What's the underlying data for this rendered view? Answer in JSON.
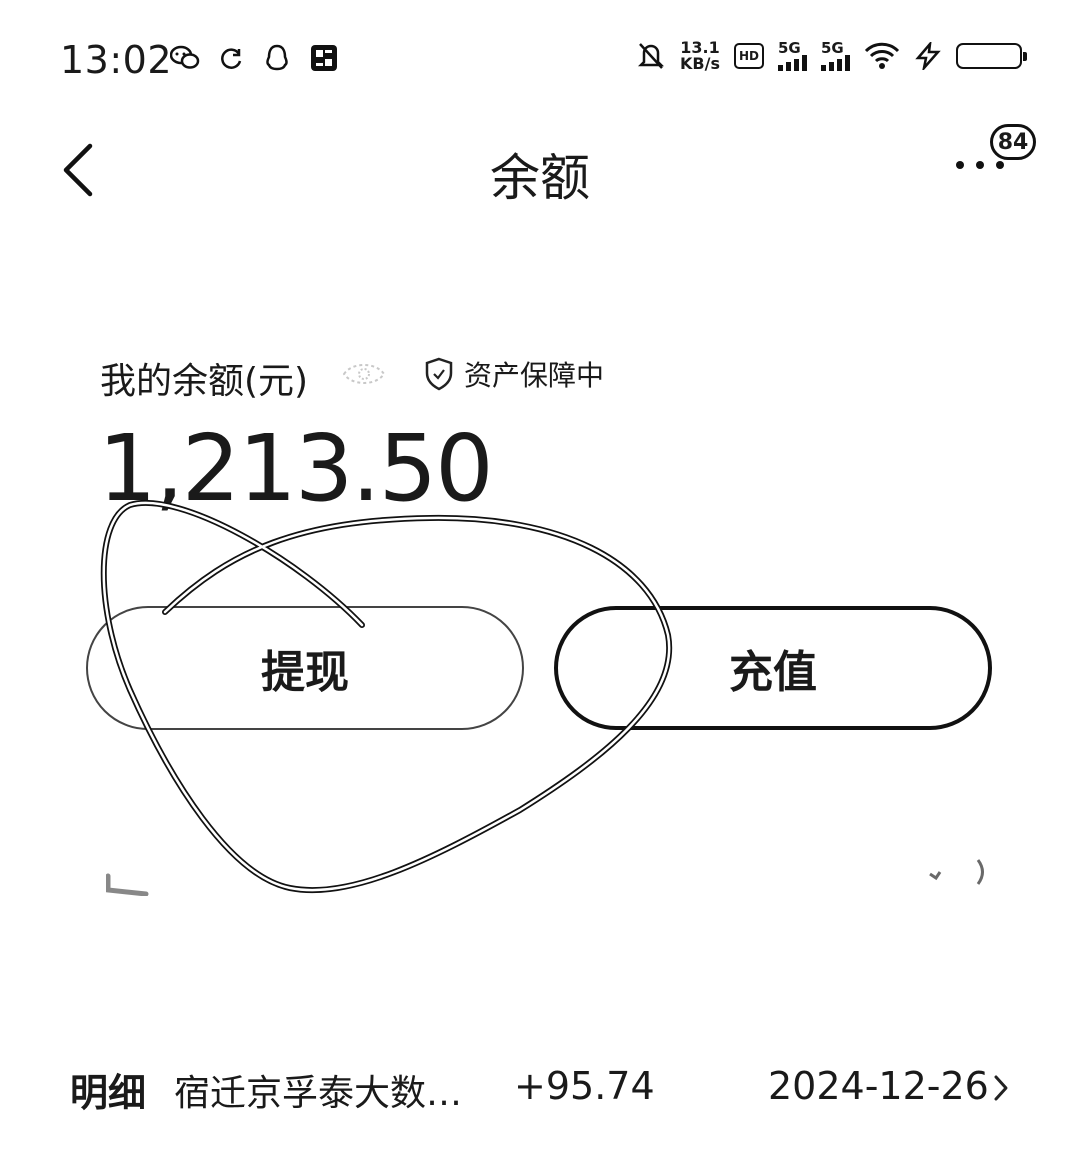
{
  "status_bar": {
    "time": "13:02",
    "net_speed_value": "13.1",
    "net_speed_unit": "KB/s",
    "hd_label": "HD",
    "sim1_label": "5G",
    "sim2_label": "5G",
    "icons": [
      "wechat-icon",
      "sync-icon",
      "qq-icon",
      "app-icon",
      "mute-icon",
      "wifi-icon",
      "charging-icon",
      "battery-icon"
    ]
  },
  "header": {
    "title": "余额",
    "notification_count": "84"
  },
  "balance": {
    "label": "我的余额(元)",
    "protection_text": "资产保障中",
    "amount": "1,213.50"
  },
  "actions": {
    "withdraw_label": "提现",
    "recharge_label": "充值"
  },
  "details": {
    "label": "明细",
    "merchant": "宿迁京孚泰大数…",
    "amount": "+95.74",
    "date": "2024-12-26"
  }
}
